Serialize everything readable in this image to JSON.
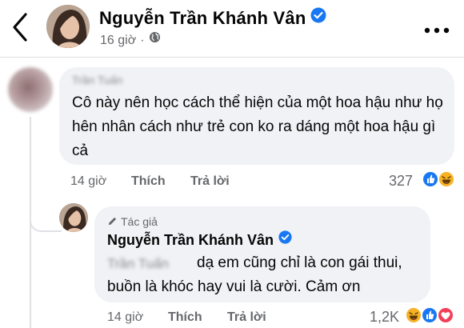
{
  "header": {
    "name": "Nguyễn Trần Khánh Vân",
    "time": "16 giờ",
    "dot": "·"
  },
  "comment": {
    "author": "Trần Tuấn",
    "text": "Cô này nên học cách thể hiện của một hoa hậu như họ hên nhân cách như trẻ con ko ra dáng một hoa hậu gì cả",
    "time": "14 giờ",
    "like_label": "Thích",
    "reply_label": "Trả lời",
    "reaction_count": "327",
    "reactions": [
      "like",
      "haha"
    ]
  },
  "reply": {
    "badge": "Tác giả",
    "author": "Nguyễn Trần Khánh Vân",
    "mention": "Trần Tuấn",
    "text": "dạ em cũng chỉ là con gái thui, buồn là khóc hay vui là cười. Cảm ơn",
    "time": "14 giờ",
    "like_label": "Thích",
    "reply_label": "Trả lời",
    "reaction_count": "1,2K",
    "reactions": [
      "haha",
      "like",
      "love"
    ]
  },
  "colors": {
    "verified": "#1877f2",
    "like": "#1877f2",
    "love": "#f33e58",
    "haha": "#f7b125",
    "bubble": "#f0f2f5",
    "secondary_text": "#65676b"
  }
}
